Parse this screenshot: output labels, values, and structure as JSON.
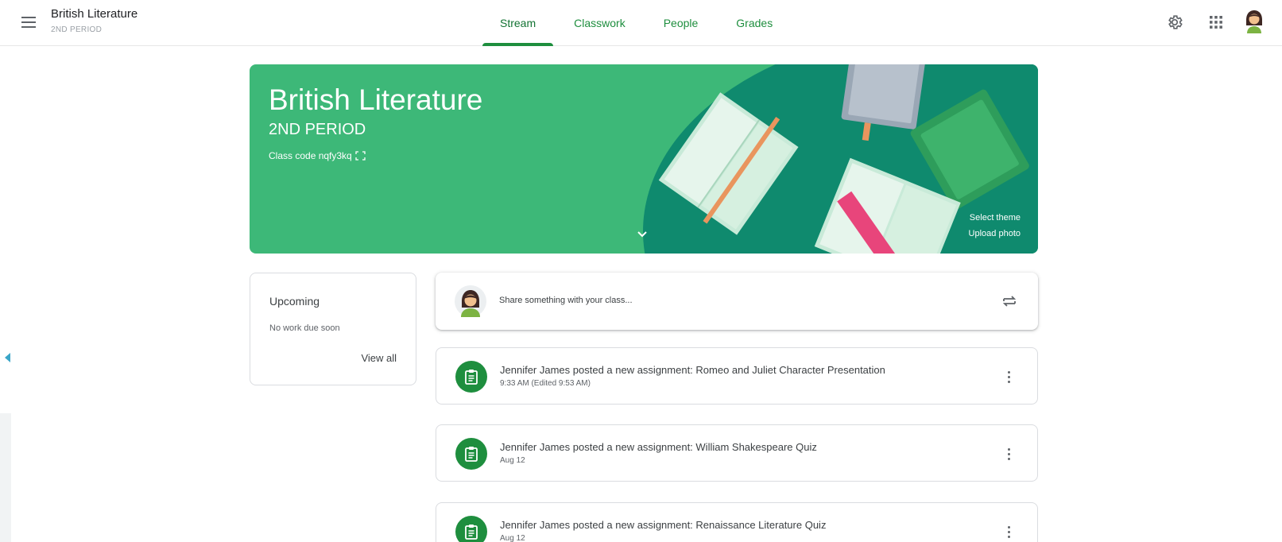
{
  "header": {
    "class_name": "British Literature",
    "class_section": "2ND PERIOD",
    "tabs": [
      "Stream",
      "Classwork",
      "People",
      "Grades"
    ],
    "active_tab": "Stream",
    "icons": [
      "menu-icon",
      "settings-icon",
      "apps-grid-icon",
      "user-avatar"
    ]
  },
  "banner": {
    "title": "British Literature",
    "section": "2ND PERIOD",
    "class_code": "Class code  nqfy3kq",
    "select_theme": "Select theme",
    "upload_photo": "Upload photo",
    "theme_color": "#3db878",
    "accent_dark": "#0f8a6e"
  },
  "upcoming": {
    "title": "Upcoming",
    "empty_text": "No work due soon",
    "view_all": "View all"
  },
  "share": {
    "placeholder": "Share something with your class..."
  },
  "posts": [
    {
      "title": "Jennifer James posted a new assignment: Romeo and Juliet Character Presentation",
      "time": "9:33 AM (Edited 9:53 AM)"
    },
    {
      "title": "Jennifer James posted a new assignment: William Shakespeare Quiz",
      "time": "Aug 12"
    },
    {
      "title": "Jennifer James posted a new assignment: Renaissance Literature Quiz",
      "time": "Aug 12"
    }
  ],
  "colors": {
    "primary_green": "#1e8e3e",
    "text": "#3c4043",
    "muted": "#5f6368"
  }
}
